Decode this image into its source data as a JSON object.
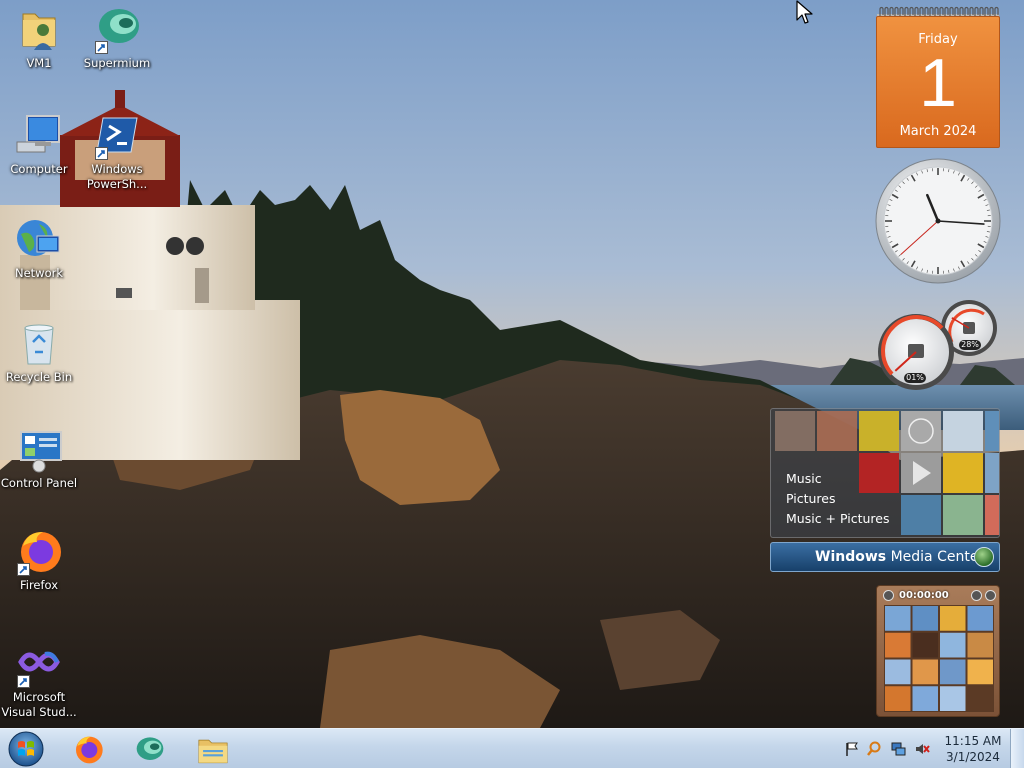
{
  "desktop": {
    "icons": [
      {
        "name": "user-folder",
        "label": "VM1",
        "shortcut": false
      },
      {
        "name": "supermium",
        "label": "Supermium",
        "shortcut": true
      },
      {
        "name": "computer",
        "label": "Computer",
        "shortcut": false
      },
      {
        "name": "powershell",
        "label": "Windows PowerSh...",
        "shortcut": true
      },
      {
        "name": "network",
        "label": "Network",
        "shortcut": false
      },
      {
        "name": "recycle-bin",
        "label": "Recycle Bin",
        "shortcut": false
      },
      {
        "name": "control-panel",
        "label": "Control Panel",
        "shortcut": false
      },
      {
        "name": "firefox",
        "label": "Firefox",
        "shortcut": true
      },
      {
        "name": "visual-studio",
        "label": "Microsoft Visual Stud...",
        "shortcut": true
      }
    ]
  },
  "gadgets": {
    "calendar": {
      "weekday": "Friday",
      "day": "1",
      "month_year": "March 2024"
    },
    "clock": {
      "hour": 11,
      "minute": 15,
      "second": 38
    },
    "cpu_meter": {
      "cpu": "01%",
      "cpu_fraction": 0.01,
      "memory": "28%",
      "memory_fraction": 0.28
    },
    "media_center": {
      "menu": [
        "Music",
        "Pictures",
        "Music + Pictures"
      ],
      "bar_bold": "Windows",
      "bar_rest": " Media Center"
    },
    "puzzle": {
      "timer": "00:00:00"
    }
  },
  "taskbar": {
    "pinned": [
      "start-orb",
      "firefox",
      "supermium",
      "file-explorer"
    ],
    "tray": [
      "action-center-flag-icon",
      "search-magnifier-icon",
      "network-icon",
      "volume-muted-icon"
    ],
    "time": "11:15 AM",
    "date": "3/1/2024"
  },
  "colors": {
    "calendar_orange": "#e57a2a",
    "taskbar": "#c4d6ea",
    "media_center_bar": "#2a5a8a"
  }
}
